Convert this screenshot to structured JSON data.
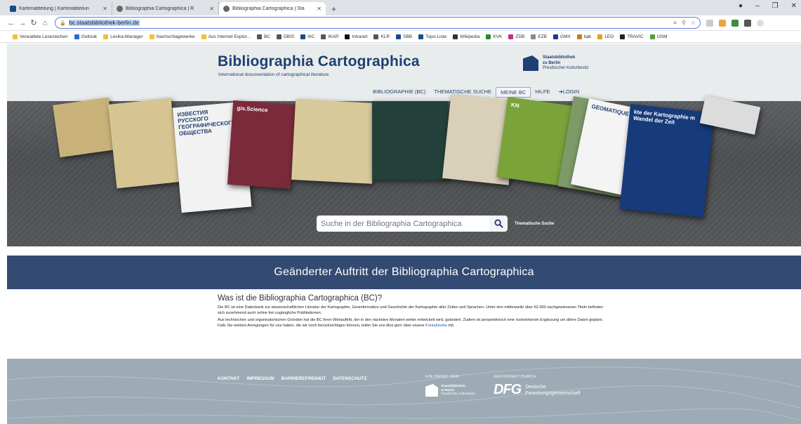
{
  "browser": {
    "tabs": [
      {
        "title": "Kartenabteilung | Kartenabteilun",
        "active": false
      },
      {
        "title": "Bibliographia Cartographica | R",
        "active": false
      },
      {
        "title": "Bibliographia Cartographica | Sta",
        "active": true
      }
    ],
    "new_tab": "+",
    "url": "bc.staatsbibliothek-berlin.de",
    "bookmarks": [
      "Verwaltete Lesezeichen",
      "Outlook",
      "Lexika-Manager",
      "Nachschlagewerke",
      "Aus Internet Explor...",
      "BC",
      "DBIS",
      "IIIC",
      "IKAR",
      "Intranet",
      "KLR",
      "SBB",
      "Topo-Liste",
      "Wikipedia",
      "KVK",
      "ZDB",
      "EZB",
      "GMX",
      "bpk",
      "LEO",
      "TRAVIC",
      "OSM"
    ]
  },
  "header": {
    "title": "Bibliographia Cartographica",
    "subtitle": "International documentation of cartographical literature",
    "logo_line1": "Staatsbibliothek",
    "logo_line2": "zu Berlin",
    "logo_line3": "Preußischer Kulturbesitz",
    "nav": [
      {
        "label": "BIBLIOGRAPHIE (BC)",
        "active": false
      },
      {
        "label": "THEMATISCHE SUCHE",
        "active": false
      },
      {
        "label": "MEINE BC",
        "active": true
      },
      {
        "label": "HILFE",
        "active": false
      },
      {
        "label": "LOGIN",
        "active": false
      }
    ]
  },
  "hero": {
    "search_placeholder": "Suche in der Bibliographia Cartographica",
    "thematic_link": "Thematische Suche",
    "covers": [
      {
        "label": "",
        "color": "#c9b27a"
      },
      {
        "label": "",
        "color": "#d7c493"
      },
      {
        "label": "ИЗВЕСТИЯ РУССКОГО ГЕОГРАФИЧЕСКОГО ОБЩЕСТВА",
        "color": "#f2f2f2"
      },
      {
        "label": "gis.Science",
        "color": "#7a2a3a"
      },
      {
        "label": "",
        "color": "#d8c99a"
      },
      {
        "label": "",
        "color": "#23413a"
      },
      {
        "label": "",
        "color": "#d8d0b8"
      },
      {
        "label": "KN",
        "color": "#7aa33a"
      },
      {
        "label": "",
        "color": "#7d9a68"
      },
      {
        "label": "GEOMATIQUE",
        "color": "#f4f4f4"
      },
      {
        "label": "kte der Kartographie m Wandel der Zeit",
        "color": "#173a7a"
      },
      {
        "label": "",
        "color": "#dcdcdc"
      }
    ]
  },
  "banner": {
    "text": "Geänderter Auftritt der Bibliographia Cartographica"
  },
  "content": {
    "heading": "Was ist die Bibliographia Cartographica (BC)?",
    "p1": "Die BC ist eine Datenbank zur wissenschaftlichen Literatur der Kartographie, Geoinformation und Geschichte der Kartographie aller Zeiten und Sprachen. Unter den mittlerweile über 62.000 nachgewiesenen Titeln befinden sich zunehmend auch online frei zugängliche Publikationen.",
    "p2": "Aus technischen und organisatorischen Gründen hat die BC ihren Webauftritt, der in den nächsten Monaten weiter entwickelt wird, geändert. Zudem ist perspektivisch eine rückwirkende Ergänzung um ältere Daten geplant.",
    "p3_before": "Falls Sie weitere Anregungen für uns haben, die wir noch berücksichtigen können, teilen Sie uns dies gern über unsere ",
    "p3_link": "Kontaktseite",
    "p3_after": " mit."
  },
  "footer": {
    "links": [
      "KONTAKT",
      "IMPRESSUM",
      "BARRIEREFREIHEIT",
      "DATENSCHUTZ"
    ],
    "service_label": "EIN DIENST DER",
    "funded_label": "GEFÖRDERT DURCH",
    "sbb_line1": "Staatsbibliothek",
    "sbb_line2": "zu Berlin",
    "sbb_line3": "Preußischer Kulturbesitz",
    "dfg_mark": "DFG",
    "dfg_line1": "Deutsche",
    "dfg_line2": "Forschungsgemeinschaft"
  }
}
